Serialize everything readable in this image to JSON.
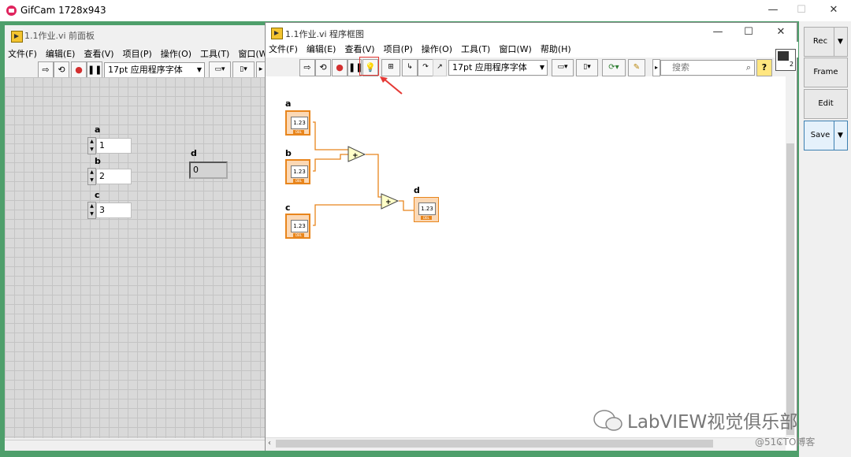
{
  "gifcam": {
    "title": "GifCam 1728x943",
    "buttons": {
      "rec": "Rec",
      "frame": "Frame",
      "edit": "Edit",
      "save": "Save"
    }
  },
  "front_panel": {
    "title": "1.1作业.vi 前面板",
    "menu": [
      "文件(F)",
      "编辑(E)",
      "查看(V)",
      "项目(P)",
      "操作(O)",
      "工具(T)",
      "窗口(W)"
    ],
    "font": "17pt 应用程序字体",
    "controls": [
      {
        "label": "a",
        "value": "1"
      },
      {
        "label": "b",
        "value": "2"
      },
      {
        "label": "c",
        "value": "3"
      }
    ],
    "indicator": {
      "label": "d",
      "value": "0"
    }
  },
  "block_diagram": {
    "title": "1.1作业.vi 程序框图",
    "menu": [
      "文件(F)",
      "编辑(E)",
      "查看(V)",
      "项目(P)",
      "操作(O)",
      "工具(T)",
      "窗口(W)",
      "帮助(H)"
    ],
    "font": "17pt 应用程序字体",
    "search_placeholder": "搜索",
    "terminals": {
      "a": "a",
      "b": "b",
      "c": "c",
      "d": "d"
    },
    "term_value": "1.23",
    "term_sub": "DBL",
    "add_symbol": "+",
    "connector_badge": "2"
  },
  "watermark": {
    "main": "LabVIEW视觉俱乐部",
    "sub": "@51CTO博客"
  },
  "colors": {
    "wire": "#e8851c",
    "terminal_border": "#e8851c",
    "highlight": "#e53935",
    "gifcam_frame": "#4e9f6b"
  }
}
